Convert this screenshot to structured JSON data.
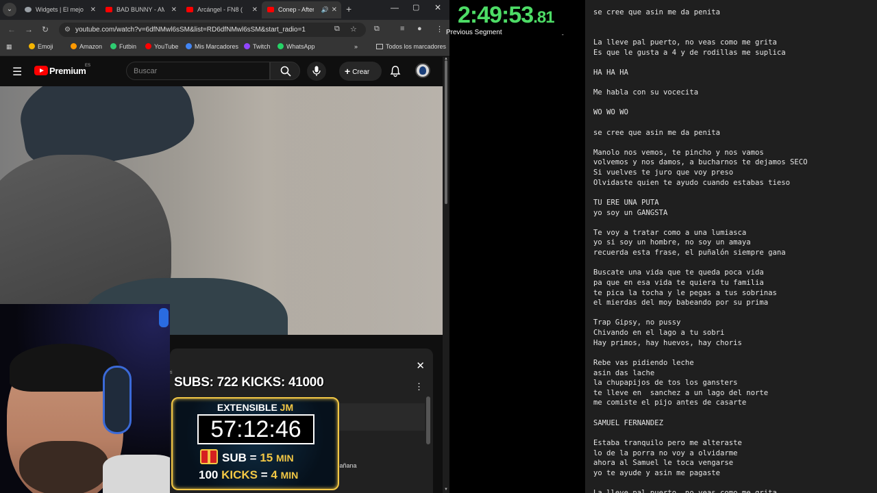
{
  "browser": {
    "tabs": [
      {
        "label": "Widgets | El mejor",
        "icon": "widget-icon"
      },
      {
        "label": "BAD BUNNY - AM",
        "icon": "youtube-icon"
      },
      {
        "label": "Arcángel - FN8 (",
        "icon": "youtube-icon"
      },
      {
        "label": "Conep - After",
        "icon": "youtube-icon",
        "active": true
      }
    ],
    "url": "youtube.com/watch?v=6dfNMwl6sSM&list=RD6dfNMwl6sSM&start_radio=1",
    "bookmarks": [
      {
        "label": "Emoji",
        "color": "#f4b400"
      },
      {
        "label": "Amazon",
        "color": "#ff9900"
      },
      {
        "label": "Futbin",
        "color": "#2ecc71"
      },
      {
        "label": "YouTube",
        "color": "#ff0000"
      },
      {
        "label": "Mis Marcadores",
        "color": "#4285f4"
      },
      {
        "label": "Twitch",
        "color": "#9146ff"
      },
      {
        "label": "WhatsApp",
        "color": "#25d366"
      }
    ],
    "all_bookmarks": "Todos los marcadores",
    "more_bookmarks": "»"
  },
  "youtube": {
    "brand": "Premium",
    "region": "ES",
    "search_placeholder": "Buscar",
    "create_label": "Crear"
  },
  "panel": {
    "fragment_left": "ti",
    "fragment_text": "mañana"
  },
  "overlay": {
    "subs_kicks": "SUBS: 722  KICKS: 41000",
    "timer_title_white": "EXTENSIBLE",
    "timer_title_gold": "JM",
    "timer_clock": "57:12:46",
    "sub_rule_a": "SUB",
    "sub_rule_eq": "=",
    "sub_rule_val": "15",
    "sub_rule_unit": "MIN",
    "kicks_rule_count": "100",
    "kicks_rule_label": "KICKS",
    "kicks_rule_eq": "=",
    "kicks_rule_val": "4",
    "kicks_rule_unit": "MIN"
  },
  "livesplit": {
    "time_main": "2:49:53",
    "time_ms": ".81",
    "label": "Previous Segment",
    "value": "-"
  },
  "lyrics": [
    "se cree que asin me da penita",
    "",
    "",
    "La lleve pal puerto, no veas como me grita",
    "Es que le gusta a 4 y de rodillas me suplica",
    "",
    "HA HA HA",
    "",
    "Me habla con su vocecita",
    "",
    "WO WO WO",
    "",
    "se cree que asin me da penita",
    "",
    "Manolo nos vemos, te pincho y nos vamos",
    "volvemos y nos damos, a bucharnos te dejamos SECO",
    "Si vuelves te juro que voy preso",
    "Olvidaste quien te ayudo cuando estabas tieso",
    "",
    "TU ERE UNA PUTA",
    "yo soy un GANGSTA",
    "",
    "Te voy a tratar como a una lumiasca",
    "yo si soy un hombre, no soy un amaya",
    "recuerda esta frase, el puñalón siempre gana",
    "",
    "Buscate una vida que te queda poca vida",
    "pa que en esa vida te quiera tu familia",
    "te pica la tocha y le pegas a tus sobrinas",
    "el mierdas del moy babeando por su prima",
    "",
    "Trap Gipsy, no pussy",
    "Chivando en el lago a tu sobri",
    "Hay primos, hay huevos, hay choris",
    "",
    "Rebe vas pidiendo leche",
    "asin das lache",
    "la chupapijos de tos los gansters",
    "te lleve en  sanchez a un lago del norte",
    "me comiste el pijo antes de casarte",
    "",
    "SAMUEL FERNANDEZ",
    "",
    "Estaba tranquilo pero me alteraste",
    "lo de la porra no voy a olvidarme",
    "ahora al Samuel le toca vengarse",
    "yo te ayude y asin me pagaste",
    "",
    "La lleve pal puerto, no veas como me grita"
  ],
  "colors": {
    "timer_green": "#4ddc66",
    "gold": "#f3c845",
    "yt_red": "#ff0000"
  }
}
